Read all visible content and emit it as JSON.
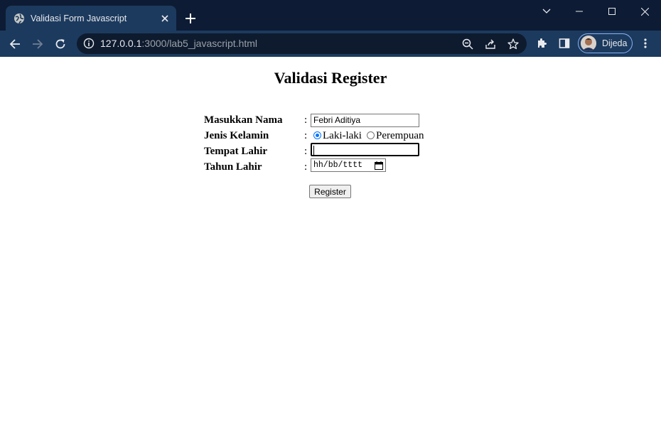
{
  "browser": {
    "tab_title": "Validasi Form Javascript",
    "url_host": "127.0.0.1",
    "url_rest": ":3000/lab5_javascript.html",
    "profile_name": "Dijeda",
    "colors": {
      "titlebar": "#0d1b34",
      "toolbar": "#1c3a5e",
      "omnibox": "#0e1b2f",
      "accent": "#8ab4f8"
    }
  },
  "page": {
    "title": "Validasi Register",
    "fields": [
      {
        "label": "Masukkan Nama",
        "value": "Febri Aditiya"
      },
      {
        "label": "Jenis Kelamin",
        "options": [
          "Laki-laki",
          "Perempuan"
        ],
        "selected": "Laki-laki"
      },
      {
        "label": "Tempat Lahir",
        "value": ""
      },
      {
        "label": "Tahun Lahir",
        "placeholder": "hh/bb/tttt"
      }
    ],
    "colon": ":",
    "submit_label": "Register"
  }
}
